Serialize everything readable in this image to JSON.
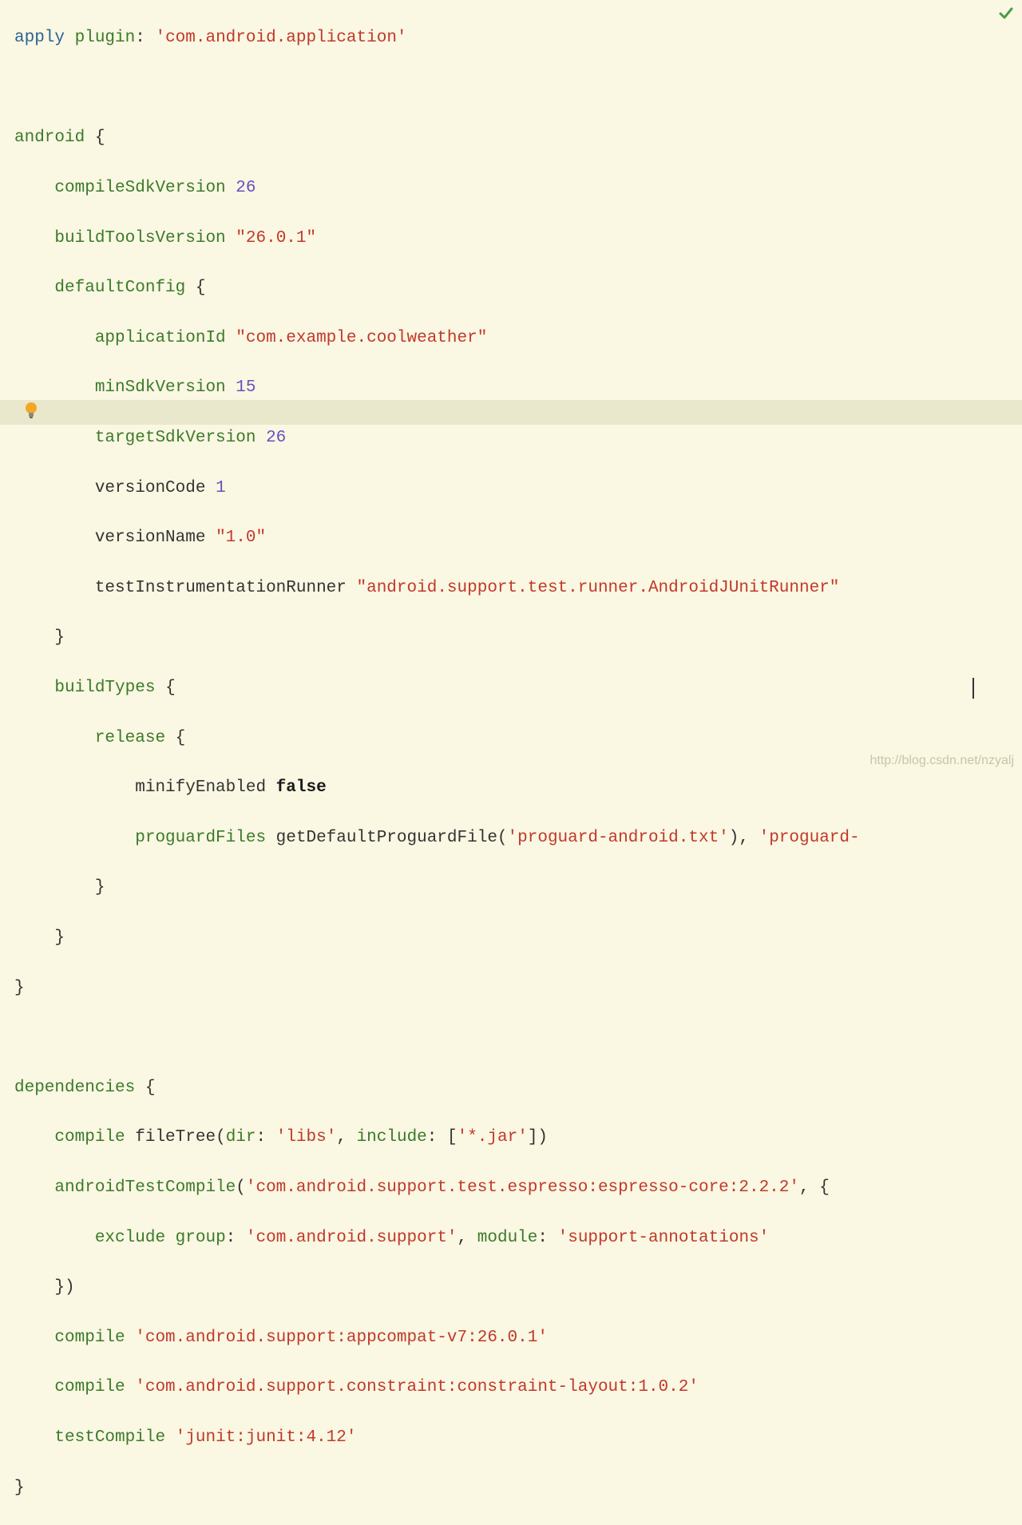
{
  "status": {
    "ok": true
  },
  "gutter": {
    "bulb_line": 16
  },
  "watermark": "http://blog.csdn.net/nzyalj",
  "code": {
    "line1": {
      "apply": "apply",
      "plugin": "plugin",
      "colon": ":",
      "val": "'com.android.application'"
    },
    "line3": {
      "android": "android",
      "brace": "{"
    },
    "line4": {
      "k": "compileSdkVersion",
      "v": "26"
    },
    "line5": {
      "k": "buildToolsVersion",
      "v": "\"26.0.1\""
    },
    "line6": {
      "k": "defaultConfig",
      "brace": "{"
    },
    "line7": {
      "k": "applicationId",
      "v": "\"com.example.coolweather\""
    },
    "line8": {
      "k": "minSdkVersion",
      "v": "15"
    },
    "line9": {
      "k": "targetSdkVersion",
      "v": "26"
    },
    "line10": {
      "k": "versionCode",
      "v": "1"
    },
    "line11": {
      "k": "versionName",
      "v": "\"1.0\""
    },
    "line12": {
      "k": "testInstrumentationRunner",
      "v": "\"android.support.test.runner.AndroidJUnitRunner\""
    },
    "line13": {
      "brace": "}"
    },
    "line14": {
      "k": "buildTypes",
      "brace": "{"
    },
    "line15": {
      "k": "release",
      "brace": "{"
    },
    "line16": {
      "k": "minifyEnabled",
      "v": "false"
    },
    "line17": {
      "k": "proguardFiles",
      "fn": "getDefaultProguardFile",
      "arg1": "'proguard-android.txt'",
      "arg2": "'proguard-"
    },
    "line18": {
      "brace": "}"
    },
    "line19": {
      "brace": "}"
    },
    "line20": {
      "brace": "}"
    },
    "line22": {
      "k": "dependencies",
      "brace": "{"
    },
    "line23": {
      "k": "compile",
      "fn": "fileTree",
      "dir_k": "dir",
      "dir_v": "'libs'",
      "inc_k": "include",
      "inc_v": "'*.jar'"
    },
    "line24": {
      "k": "androidTestCompile",
      "v": "'com.android.support.test.espresso:espresso-core:2.2.2'",
      "brace": "{"
    },
    "line25": {
      "k": "exclude",
      "grp_k": "group",
      "grp_v": "'com.android.support'",
      "mod_k": "module",
      "mod_v": "'support-annotations'"
    },
    "line26": {
      "brace": "})"
    },
    "line27": {
      "k": "compile",
      "v": "'com.android.support:appcompat-v7:26.0.1'"
    },
    "line28": {
      "k": "compile",
      "v": "'com.android.support.constraint:constraint-layout:1.0.2'"
    },
    "line29": {
      "k": "testCompile",
      "v": "'junit:junit:4.12'"
    },
    "line30": {
      "brace": "}"
    }
  }
}
